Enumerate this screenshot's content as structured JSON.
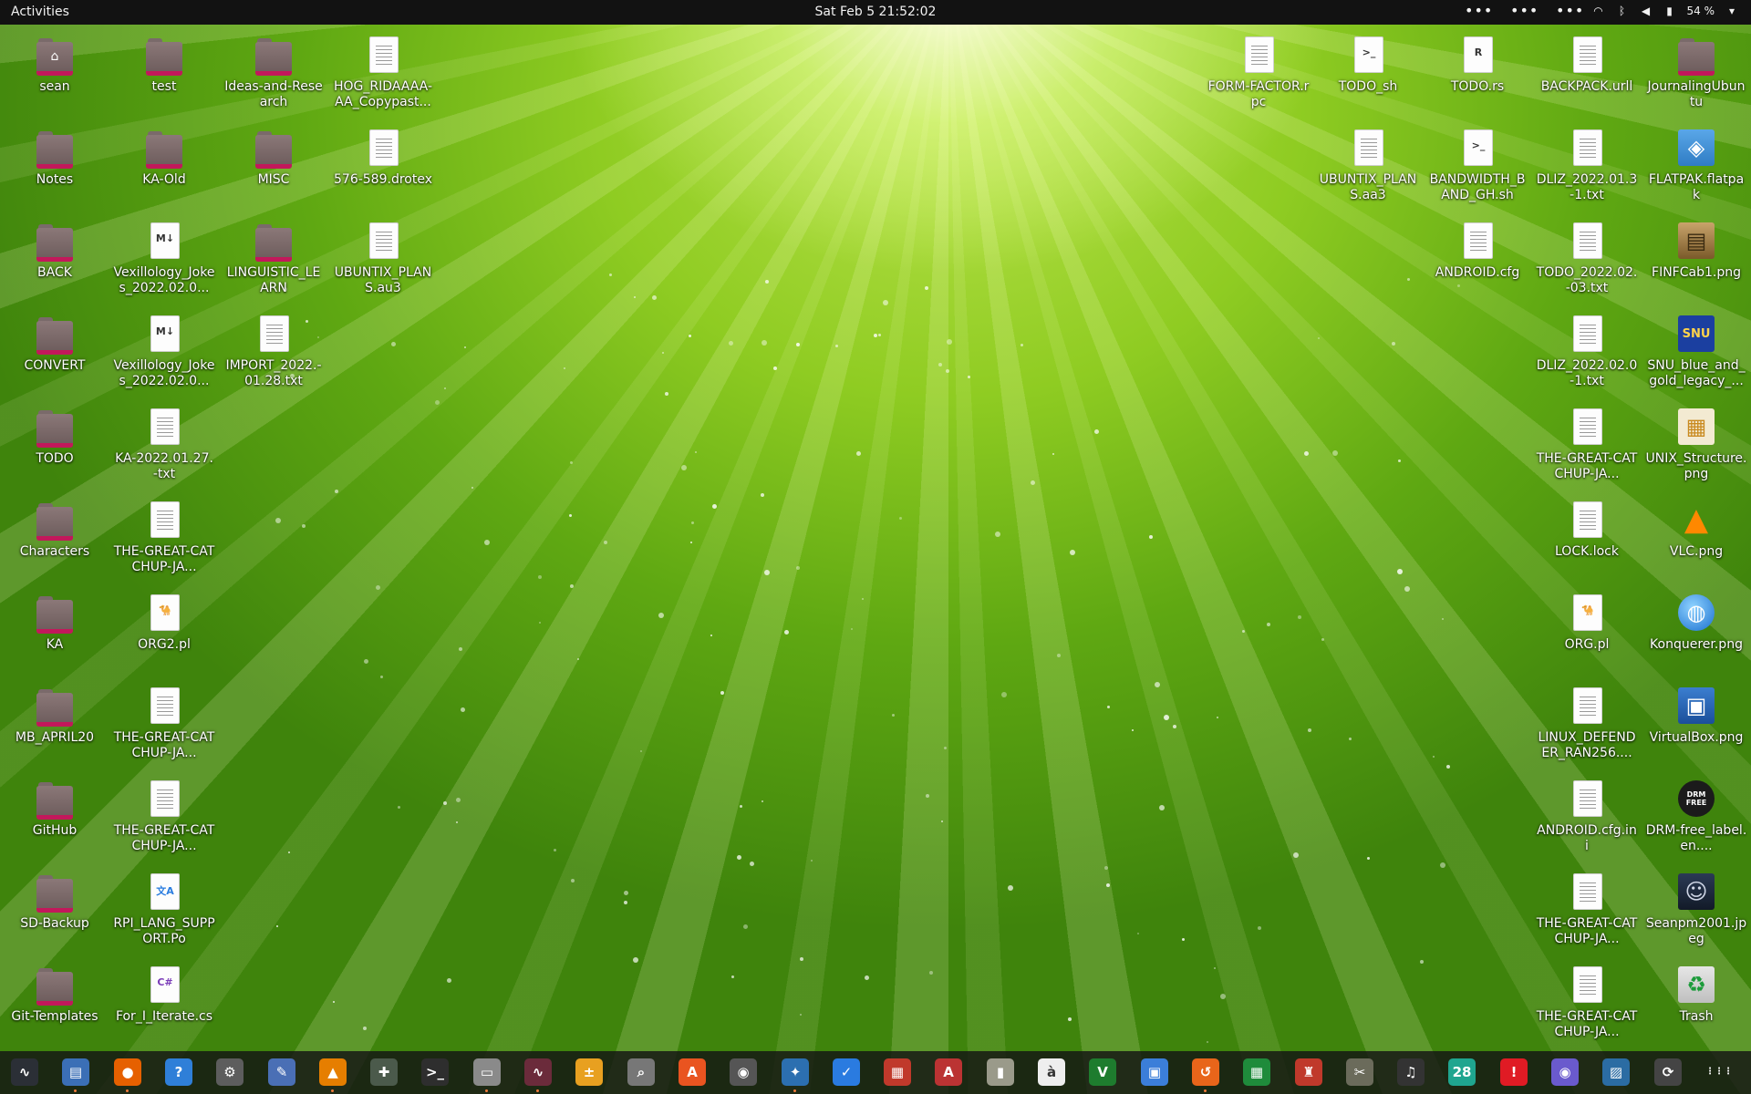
{
  "topbar": {
    "activities": "Activities",
    "clock": "Sat Feb 5  21:52:02",
    "ext_a": "•••",
    "ext_b": "•••",
    "ext_c": "•••",
    "battery": "54 %"
  },
  "desktop": {
    "left": [
      {
        "label": "sean",
        "type": "folder",
        "symbol": "⌂"
      },
      {
        "label": "test",
        "type": "folder"
      },
      {
        "label": "Ideas-and-Research",
        "type": "folder"
      },
      {
        "label": "HOG_RIDAAAA-AA_Copypast...",
        "type": "doc"
      },
      {
        "label": "Notes",
        "type": "folder"
      },
      {
        "label": "KA-Old",
        "type": "folder"
      },
      {
        "label": "MISC",
        "type": "folder"
      },
      {
        "label": "576-589.drotex",
        "type": "doc"
      },
      {
        "label": "BACK",
        "type": "folder"
      },
      {
        "label": "Vexillology_Jokes_2022.02.0...",
        "type": "md",
        "symbol": "M↓"
      },
      {
        "label": "LINGUISTIC_LEARN",
        "type": "folder"
      },
      {
        "label": "UBUNTIX_PLANS.au3",
        "type": "doc"
      },
      {
        "label": "CONVERT",
        "type": "folder"
      },
      {
        "label": "Vexillology_Jokes_2022.02.0...",
        "type": "md",
        "symbol": "M↓"
      },
      {
        "label": "IMPORT_2022.-01.28.txt",
        "type": "doc"
      },
      {
        "label": "TODO",
        "type": "folder"
      },
      {
        "label": "KA-2022.01.27.-txt",
        "type": "doc"
      },
      {
        "label": "Characters",
        "type": "folder"
      },
      {
        "label": "THE-GREAT-CATCHUP-JA...",
        "type": "doc"
      },
      {
        "label": "KA",
        "type": "folder"
      },
      {
        "label": "ORG2.pl",
        "type": "perl",
        "symbol": "🐪"
      },
      {
        "label": "MB_APRIL20",
        "type": "folder"
      },
      {
        "label": "THE-GREAT-CATCHUP-JA...",
        "type": "doc"
      },
      {
        "label": "GitHub",
        "type": "folder"
      },
      {
        "label": "THE-GREAT-CATCHUP-JA...",
        "type": "doc"
      },
      {
        "label": "SD-Backup",
        "type": "folder"
      },
      {
        "label": "RPI_LANG_SUPPORT.Po",
        "type": "po",
        "symbol": "文A"
      },
      {
        "label": "Git-Templates",
        "type": "folder"
      },
      {
        "label": "For_I_Iterate.cs",
        "type": "cs",
        "symbol": "C#"
      }
    ],
    "right": [
      {
        "label": "FORM-FACTOR.rpc",
        "type": "doc"
      },
      {
        "label": "TODO_sh",
        "type": "term",
        "symbol": ">_"
      },
      {
        "label": "TODO.rs",
        "type": "rust",
        "symbol": "R"
      },
      {
        "label": "BACKPACK.urll",
        "type": "doc"
      },
      {
        "label": "JournalingUbuntu",
        "type": "folder"
      },
      {
        "label": "UBUNTIX_PLANS.aa3",
        "type": "doc"
      },
      {
        "label": "BANDWIDTH_BAND_GH.sh",
        "type": "term",
        "symbol": ">_"
      },
      {
        "label": "DLIZ_2022.01.3-1.txt",
        "type": "doc"
      },
      {
        "label": "FLATPAK.flatpak",
        "type": "flatpak"
      },
      {
        "label": "ANDROID.cfg",
        "type": "doc"
      },
      {
        "label": "TODO_2022.02.-03.txt",
        "type": "doc"
      },
      {
        "label": "FINFCab1.png",
        "type": "cabinet"
      },
      {
        "label": "DLIZ_2022.02.0-1.txt",
        "type": "doc"
      },
      {
        "label": "SNU_blue_and_gold_legacy_...",
        "type": "snu",
        "symbol": "SNU"
      },
      {
        "label": "THE-GREAT-CATCHUP-JA...",
        "type": "doc"
      },
      {
        "label": "UNIX_Structure.png",
        "type": "unix"
      },
      {
        "label": "LOCK.lock",
        "type": "doc"
      },
      {
        "label": "VLC.png",
        "type": "vlc"
      },
      {
        "label": "ORG.pl",
        "type": "perl",
        "symbol": "🐪"
      },
      {
        "label": "Konquerer.png",
        "type": "globe"
      },
      {
        "label": "LINUX_DEFENDER_RAN256....",
        "type": "doc"
      },
      {
        "label": "VirtualBox.png",
        "type": "vbox"
      },
      {
        "label": "ANDROID.cfg.ini",
        "type": "doc"
      },
      {
        "label": "DRM-free_label.en....",
        "type": "drm",
        "symbol": "DRM FREE"
      },
      {
        "label": "THE-GREAT-CATCHUP-JA...",
        "type": "doc"
      },
      {
        "label": "Seanpm2001.jpeg",
        "type": "photo"
      },
      {
        "label": "THE-GREAT-CATCHUP-JA...",
        "type": "doc"
      },
      {
        "label": "Trash",
        "type": "trash",
        "symbol": "♻"
      }
    ]
  },
  "dock": [
    {
      "name": "system-monitor",
      "color": "#2b2f36",
      "symbol": "∿"
    },
    {
      "name": "text-editor-doc",
      "color": "#3b6fb6",
      "symbol": "▤"
    },
    {
      "name": "firefox",
      "color": "#e66000",
      "symbol": "●"
    },
    {
      "name": "help",
      "color": "#2f7fd8",
      "symbol": "?"
    },
    {
      "name": "settings",
      "color": "#5d5d5d",
      "symbol": "⚙"
    },
    {
      "name": "text-editor",
      "color": "#4a6fb5",
      "symbol": "✎"
    },
    {
      "name": "vlc",
      "color": "#e67e00",
      "symbol": "▲"
    },
    {
      "name": "extensions",
      "color": "#4b5a4b",
      "symbol": "✚"
    },
    {
      "name": "terminal",
      "color": "#2e2e2e",
      "symbol": ">_"
    },
    {
      "name": "files",
      "color": "#8a8a8a",
      "symbol": "▭"
    },
    {
      "name": "system-monitor-2",
      "color": "#6b2b3b",
      "symbol": "∿"
    },
    {
      "name": "calculator",
      "color": "#e8a020",
      "symbol": "±"
    },
    {
      "name": "image-viewer",
      "color": "#777777",
      "symbol": "⌕"
    },
    {
      "name": "software",
      "color": "#e95420",
      "symbol": "A"
    },
    {
      "name": "disks",
      "color": "#555555",
      "symbol": "◉"
    },
    {
      "name": "libreoffice-draw",
      "color": "#2c6fb0",
      "symbol": "✦"
    },
    {
      "name": "todo",
      "color": "#2a7be0",
      "symbol": "✓"
    },
    {
      "name": "document-scanner",
      "color": "#c0392b",
      "symbol": "▦"
    },
    {
      "name": "font-viewer",
      "color": "#b33",
      "symbol": "A"
    },
    {
      "name": "archive-manager",
      "color": "#9a9a8a",
      "symbol": "▮"
    },
    {
      "name": "character-map",
      "color": "#eeeeee",
      "symbol": "à"
    },
    {
      "name": "vim",
      "color": "#1e7c2e",
      "symbol": "V"
    },
    {
      "name": "remote-desktop",
      "color": "#3b7ed9",
      "symbol": "▣"
    },
    {
      "name": "backups",
      "color": "#e8651a",
      "symbol": "↺"
    },
    {
      "name": "spreadsheet",
      "color": "#1f8b3b",
      "symbol": "▦"
    },
    {
      "name": "game",
      "color": "#c0392b",
      "symbol": "♜"
    },
    {
      "name": "gimp",
      "color": "#6b6b5b",
      "symbol": "✂"
    },
    {
      "name": "music",
      "color": "#333333",
      "symbol": "♫"
    },
    {
      "name": "calendar",
      "color": "#1fa58f",
      "symbol": "28"
    },
    {
      "name": "alert",
      "color": "#e01b24",
      "symbol": "!"
    },
    {
      "name": "screenshot",
      "color": "#6a5acd",
      "symbol": "◉"
    },
    {
      "name": "system-image",
      "color": "#2b6ca3",
      "symbol": "▨"
    },
    {
      "name": "update-manager",
      "color": "#444444",
      "symbol": "⟳"
    },
    {
      "name": "show-apps",
      "color": "transparent",
      "symbol": "⋮⋮⋮"
    }
  ]
}
